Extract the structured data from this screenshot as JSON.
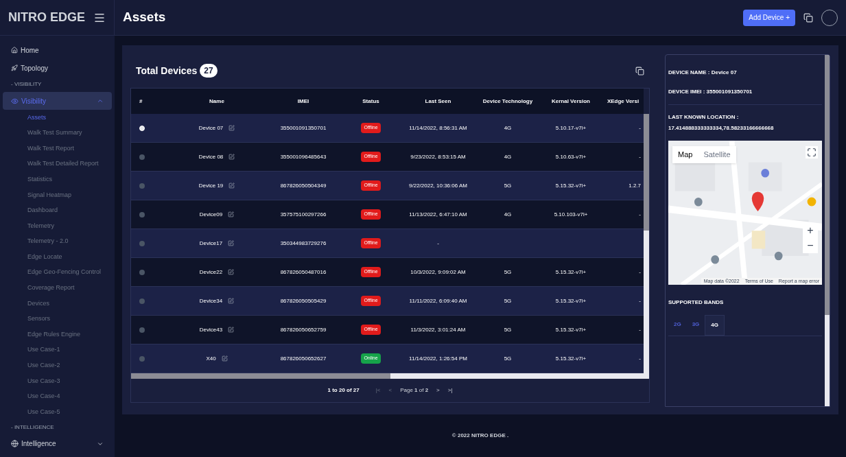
{
  "brand": "NITRO EDGE",
  "page_title": "Assets",
  "header_button": "Add Device +",
  "sidebar": {
    "items": [
      {
        "kind": "link",
        "label": "Home"
      },
      {
        "kind": "link",
        "label": "Topology"
      },
      {
        "kind": "section",
        "label": "- VISIBILITY"
      },
      {
        "kind": "group",
        "label": "Visibility",
        "expanded": true,
        "selected": true,
        "children": [
          {
            "label": "Assets",
            "selected": true
          },
          {
            "label": "Walk Test Summary",
            "selected": false
          },
          {
            "label": "Walk Test Report",
            "selected": false
          },
          {
            "label": "Walk Test Detailed Report",
            "selected": false
          },
          {
            "label": "Statistics",
            "selected": false
          },
          {
            "label": "Signal Heatmap",
            "selected": false
          },
          {
            "label": "Dashboard",
            "selected": false
          },
          {
            "label": "Telemetry",
            "selected": false
          },
          {
            "label": "Telemetry - 2.0",
            "selected": false
          },
          {
            "label": "Edge Locate",
            "selected": false
          },
          {
            "label": "Edge Geo-Fencing Control",
            "selected": false
          },
          {
            "label": "Coverage Report",
            "selected": false
          },
          {
            "label": "Devices",
            "selected": false
          },
          {
            "label": "Sensors",
            "selected": false
          },
          {
            "label": "Edge Rules Engine",
            "selected": false
          },
          {
            "label": "Use Case-1",
            "selected": false
          },
          {
            "label": "Use Case-2",
            "selected": false
          },
          {
            "label": "Use Case-3",
            "selected": false
          },
          {
            "label": "Use Case-4",
            "selected": false
          },
          {
            "label": "Use Case-5",
            "selected": false
          }
        ]
      },
      {
        "kind": "section",
        "label": "- INTELLIGENCE"
      },
      {
        "kind": "group",
        "label": "Intelligence",
        "expanded": false,
        "selected": false
      }
    ]
  },
  "devices": {
    "title": "Total Devices",
    "count": "27",
    "columns": [
      "#",
      "Name",
      "IMEI",
      "Status",
      "Last Seen",
      "Device Technology",
      "Kernal Version",
      "XEdge Versi"
    ],
    "rows": [
      {
        "selected": true,
        "name": "Device 07",
        "imei": "355001091350701",
        "status": "Offline",
        "color": "#e11b1b",
        "last_seen": "11/14/2022, 8:56:31 AM",
        "tech": "4G",
        "kernel": "5.10.17-v7l+",
        "xedge": "-"
      },
      {
        "selected": false,
        "name": "Device 08",
        "imei": "355001096485643",
        "status": "Offline",
        "color": "#e11b1b",
        "last_seen": "9/23/2022, 8:53:15 AM",
        "tech": "4G",
        "kernel": "5.10.63-v7l+",
        "xedge": "-"
      },
      {
        "selected": false,
        "name": "Device 19",
        "imei": "867826050504349",
        "status": "Offline",
        "color": "#e11b1b",
        "last_seen": "9/22/2022, 10:36:06 AM",
        "tech": "5G",
        "kernel": "5.15.32-v7l+",
        "xedge": "1.2.7"
      },
      {
        "selected": false,
        "name": "Device09",
        "imei": "357575100297266",
        "status": "Offline",
        "color": "#e11b1b",
        "last_seen": "11/13/2022, 6:47:10 AM",
        "tech": "4G",
        "kernel": "5.10.103-v7l+",
        "xedge": "-"
      },
      {
        "selected": false,
        "name": "Device17",
        "imei": "350344983729276",
        "status": "Offline",
        "color": "#e11b1b",
        "last_seen": "-"
      },
      {
        "selected": false,
        "name": "Device22",
        "imei": "867826050487016",
        "status": "Offline",
        "color": "#e11b1b",
        "last_seen": "10/3/2022, 9:09:02 AM",
        "tech": "5G",
        "kernel": "5.15.32-v7l+",
        "xedge": "-"
      },
      {
        "selected": false,
        "name": "Device34",
        "imei": "867826050505429",
        "status": "Offline",
        "color": "#e11b1b",
        "last_seen": "11/11/2022, 6:09:40 AM",
        "tech": "5G",
        "kernel": "5.15.32-v7l+",
        "xedge": "-"
      },
      {
        "selected": false,
        "name": "Device43",
        "imei": "867826050652759",
        "status": "Offline",
        "color": "#e11b1b",
        "last_seen": "11/3/2022, 3:01:24 AM",
        "tech": "5G",
        "kernel": "5.15.32-v7l+",
        "xedge": "-"
      },
      {
        "selected": false,
        "name": "X40",
        "imei": "867826050652627",
        "status": "Online",
        "color": "#16a34a",
        "last_seen": "11/14/2022, 1:26:54 PM",
        "tech": "5G",
        "kernel": "5.15.32-v7l+",
        "xedge": "-"
      }
    ],
    "range": "1 to 20 of 27",
    "page": "Page **1** of **2**",
    "pager": [
      "|<",
      "<",
      ">",
      ">|"
    ]
  },
  "detail": {
    "device_name": "DEVICE NAME : Device 07",
    "device_imei": "DEVICE IMEI : 355001091350701",
    "location_label": "LAST KNOWN LOCATION :",
    "location": "17.414888333333334,78.58233166666668",
    "map": {
      "kind": "picture",
      "types": [
        {
          "label": "Map",
          "selected": true
        },
        {
          "label": "Satellite",
          "selected": false
        }
      ],
      "zoom": [
        "+",
        "−"
      ],
      "attribution": [
        "Map data ©2022",
        "Terms of Use",
        "Report a map error"
      ]
    },
    "bands_title": "SUPPORTED BANDS",
    "bands": [
      {
        "label": "2G",
        "selected": false
      },
      {
        "label": "3G",
        "selected": false
      },
      {
        "label": "4G",
        "selected": true
      }
    ]
  },
  "footer": "© 2022 NITRO EDGE ."
}
